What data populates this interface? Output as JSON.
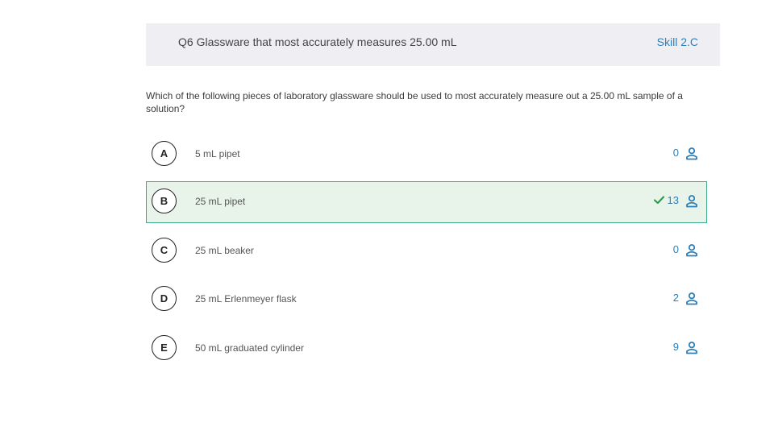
{
  "header": {
    "title": "Q6 Glassware that most accurately measures 25.00 mL",
    "skill": "Skill 2.C"
  },
  "question": {
    "text": "Which of the following pieces of laboratory glassware should be used to most accurately measure out a 25.00 mL sample of a solution?"
  },
  "colors": {
    "accent": "#2e7eb8",
    "correct_border": "#3daa8c",
    "correct_bg": "#e8f4ea",
    "check": "#2e9a4a"
  },
  "options": [
    {
      "letter": "A",
      "text": "5 mL pipet",
      "count": "0",
      "correct": false
    },
    {
      "letter": "B",
      "text": "25 mL pipet",
      "count": "13",
      "correct": true
    },
    {
      "letter": "C",
      "text": "25 mL beaker",
      "count": "0",
      "correct": false
    },
    {
      "letter": "D",
      "text": "25 mL Erlenmeyer flask",
      "count": "2",
      "correct": false
    },
    {
      "letter": "E",
      "text": "50 mL graduated cylinder",
      "count": "9",
      "correct": false
    }
  ]
}
